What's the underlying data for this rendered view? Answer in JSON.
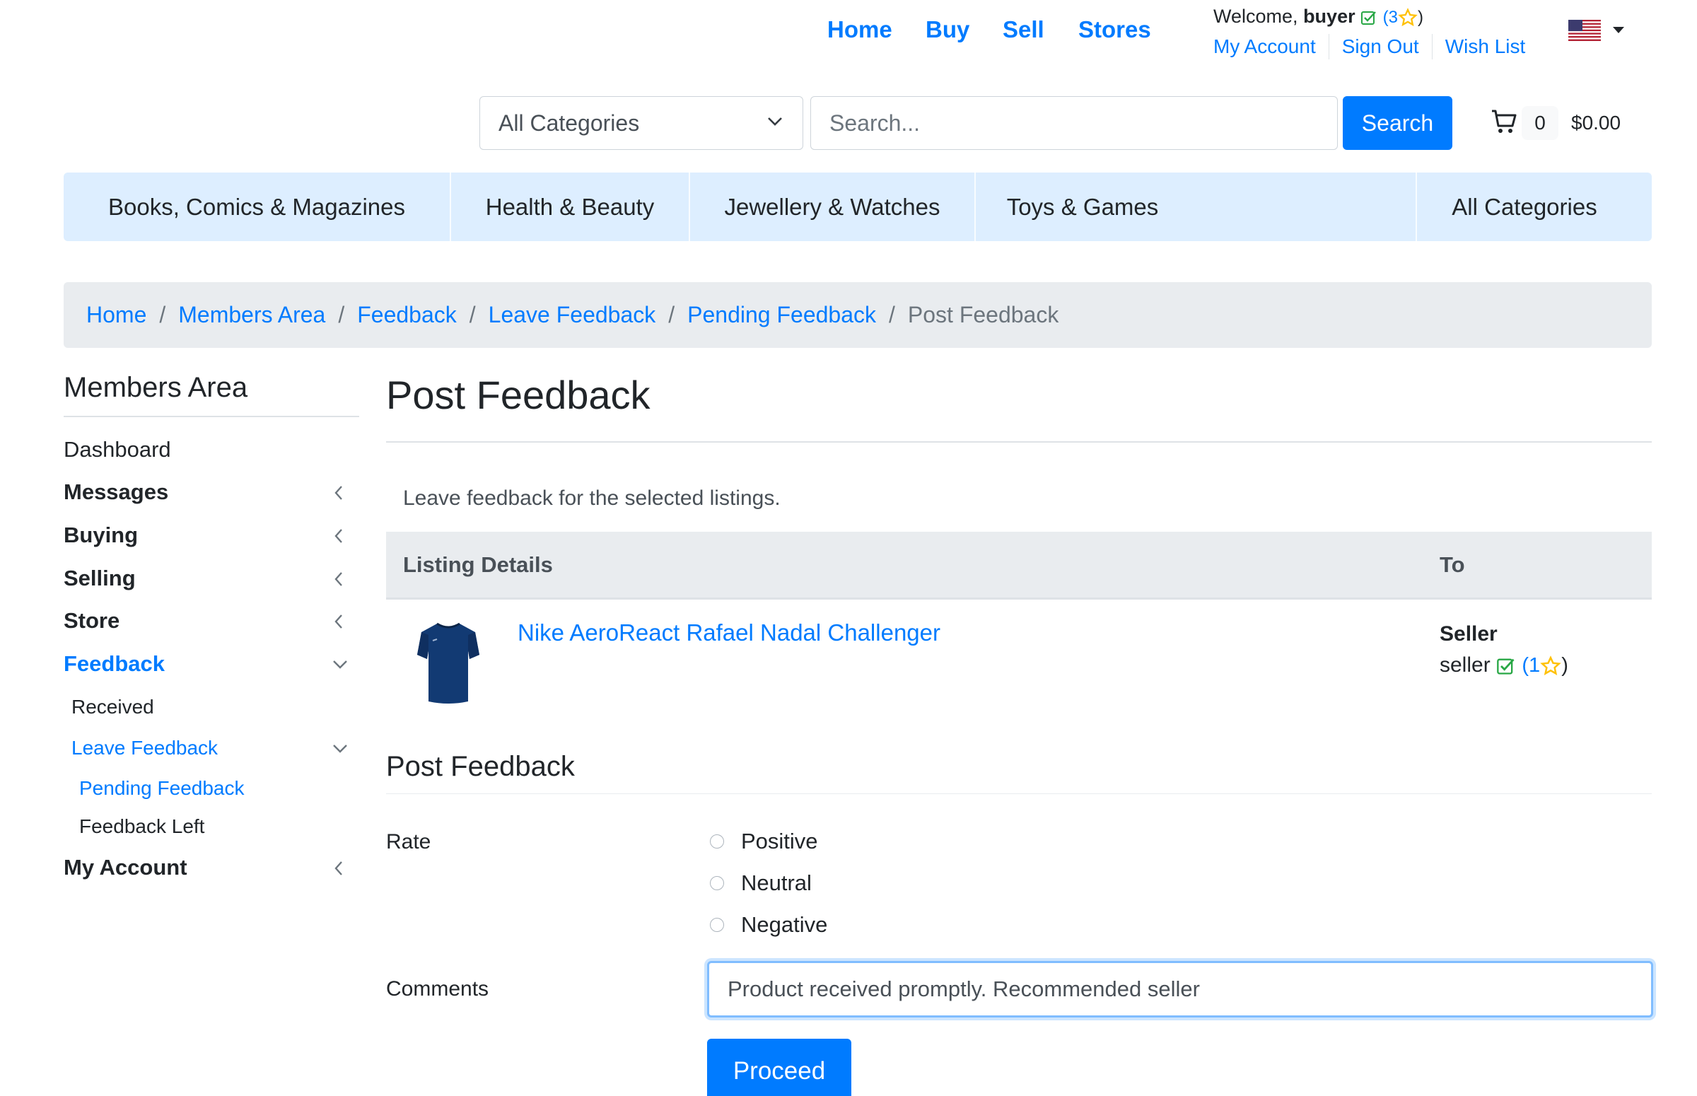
{
  "topnav": {
    "home": "Home",
    "buy": "Buy",
    "sell": "Sell",
    "stores": "Stores"
  },
  "user": {
    "welcome": "Welcome,",
    "username": "buyer",
    "rating_open": "(3",
    "rating_close": ")",
    "links": [
      "My Account",
      "Sign Out",
      "Wish List"
    ]
  },
  "locale_flag": "us-flag-icon",
  "search": {
    "category_selected": "All Categories",
    "placeholder": "Search...",
    "button": "Search"
  },
  "cart": {
    "count": "0",
    "total": "$0.00"
  },
  "categories": [
    "Books, Comics & Magazines",
    "Health & Beauty",
    "Jewellery & Watches",
    "Toys & Games",
    "All Categories"
  ],
  "breadcrumb": {
    "items": [
      "Home",
      "Members Area",
      "Feedback",
      "Leave Feedback",
      "Pending Feedback"
    ],
    "separator": "/",
    "current": "Post Feedback"
  },
  "sidebar": {
    "title": "Members Area",
    "dashboard": "Dashboard",
    "messages": "Messages",
    "buying": "Buying",
    "selling": "Selling",
    "store": "Store",
    "feedback": "Feedback",
    "received": "Received",
    "leave_feedback": "Leave Feedback",
    "pending_feedback": "Pending Feedback",
    "feedback_left": "Feedback Left",
    "my_account": "My Account"
  },
  "main": {
    "title": "Post Feedback",
    "intro": "Leave feedback for the selected listings.",
    "table": {
      "col_listing": "Listing Details",
      "col_to": "To",
      "listing_title": "Nike AeroReact Rafael Nadal Challenger",
      "to_role": "Seller",
      "to_name": "seller",
      "to_rating_open": "(1",
      "to_rating_close": ")"
    },
    "form": {
      "section_title": "Post Feedback",
      "rate_label": "Rate",
      "options": [
        "Positive",
        "Neutral",
        "Negative"
      ],
      "comments_label": "Comments",
      "comments_value": "Product received promptly. Recommended seller",
      "submit": "Proceed"
    }
  },
  "colors": {
    "primary": "#007bff",
    "category_bar": "#ddeeff",
    "breadcrumb_bg": "#e9ecef",
    "verified_green": "#28a745",
    "star_yellow": "#ffc107"
  }
}
